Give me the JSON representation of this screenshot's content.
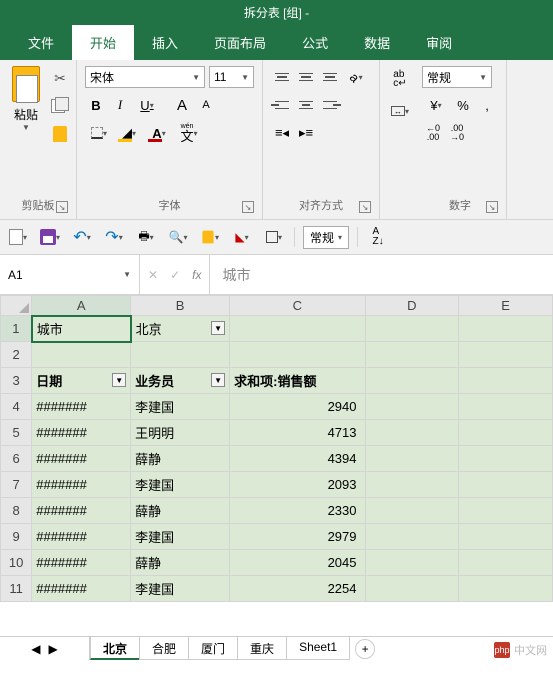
{
  "titlebar": {
    "text": "拆分表 [组] -"
  },
  "ribbon": {
    "tabs": [
      "文件",
      "开始",
      "插入",
      "页面布局",
      "公式",
      "数据",
      "审阅"
    ],
    "active_tab": 1,
    "clipboard": {
      "paste_label": "粘贴",
      "group_label": "剪贴板"
    },
    "font": {
      "font_name": "宋体",
      "font_size": "11",
      "group_label": "字体",
      "bold": "B",
      "italic": "I",
      "underline": "U",
      "grow": "A",
      "shrink": "A",
      "wen": "wén",
      "wen_char": "文"
    },
    "align": {
      "group_label": "对齐方式",
      "wrap": "ab",
      "wrap_arrow": "c↵"
    },
    "number": {
      "format": "常规",
      "group_label": "数字",
      "currency": "¥",
      "percent": "%",
      "comma": ",",
      "inc_dec": ".0",
      "inc_dec2": ".00"
    }
  },
  "qat": {
    "style": "常规"
  },
  "namebox": {
    "ref": "A1"
  },
  "formula": {
    "value": "城市"
  },
  "columns": [
    "A",
    "B",
    "C",
    "D",
    "E"
  ],
  "grid": {
    "r1": {
      "a": "城市",
      "b": "北京"
    },
    "r3": {
      "a": "日期",
      "b": "业务员",
      "c": "求和项:销售额"
    },
    "rows": [
      {
        "n": "4",
        "a": "#######",
        "b": "李建国",
        "c": "2940"
      },
      {
        "n": "5",
        "a": "#######",
        "b": "王明明",
        "c": "4713"
      },
      {
        "n": "6",
        "a": "#######",
        "b": "薛静",
        "c": "4394"
      },
      {
        "n": "7",
        "a": "#######",
        "b": "李建国",
        "c": "2093"
      },
      {
        "n": "8",
        "a": "#######",
        "b": "薛静",
        "c": "2330"
      },
      {
        "n": "9",
        "a": "#######",
        "b": "李建国",
        "c": "2979"
      },
      {
        "n": "10",
        "a": "#######",
        "b": "薛静",
        "c": "2045"
      },
      {
        "n": "11",
        "a": "#######",
        "b": "李建国",
        "c": "2254"
      }
    ]
  },
  "sheets": {
    "tabs": [
      "北京",
      "合肥",
      "厦门",
      "重庆",
      "Sheet1"
    ],
    "active": 0
  },
  "watermark": {
    "text": "中文网",
    "logo": "php"
  }
}
